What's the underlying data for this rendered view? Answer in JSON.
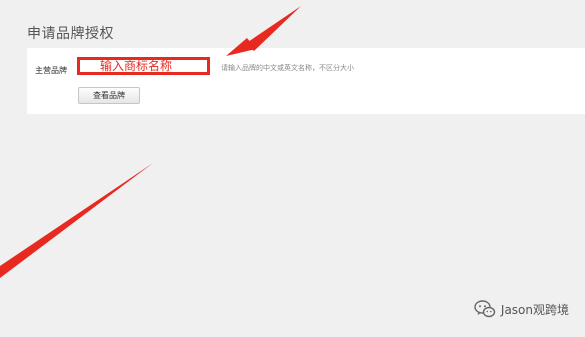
{
  "page": {
    "title": "申请品牌授权"
  },
  "form": {
    "brand_label": "主营品牌",
    "brand_input_placeholder": "输入商标名称",
    "brand_hint": "请输入品牌的中文或英文名称，不区分大小",
    "view_brand_button": "查看品牌"
  },
  "annotation": {
    "arrow_color": "#e8291f",
    "highlight_color": "#e8291f"
  },
  "watermark": {
    "text": "Jason观跨境",
    "icon": "wechat-icon"
  }
}
